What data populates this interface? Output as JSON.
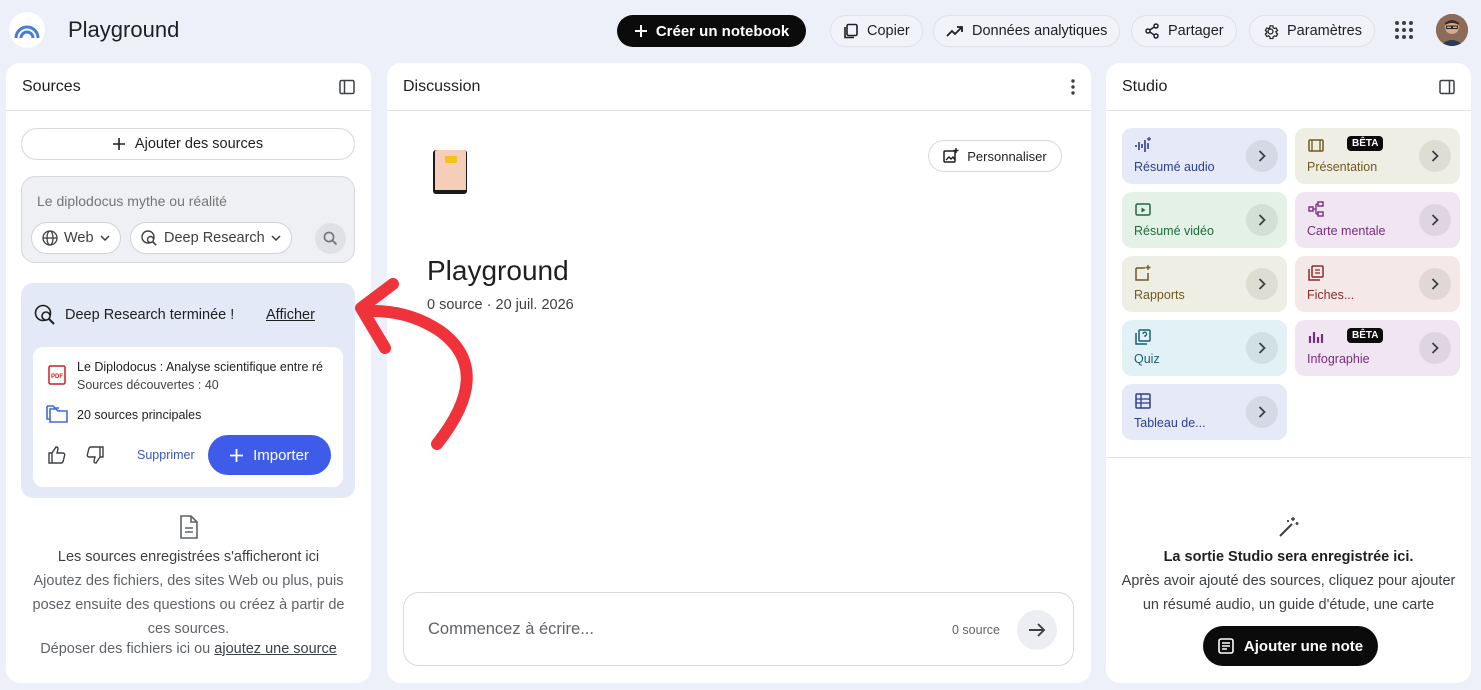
{
  "topbar": {
    "title": "Playground",
    "create_label": "Créer un notebook",
    "copy_label": "Copier",
    "analytics_label": "Données analytiques",
    "share_label": "Partager",
    "settings_label": "Paramètres"
  },
  "sources": {
    "header": "Sources",
    "add_label": "Ajouter des sources",
    "search_placeholder": "Le diplodocus mythe ou réalité",
    "chip_web": "Web",
    "chip_research": "Deep Research",
    "deep_research": {
      "status": "Deep Research terminée !",
      "show_label": "Afficher",
      "doc_title": "Le Diplodocus : Analyse scientifique entre ré",
      "doc_sub": "Sources découvertes : 40",
      "top_sources": "20 sources principales",
      "delete_label": "Supprimer",
      "import_label": "Importer"
    },
    "empty_heading": "Les sources enregistrées s'afficheront ici",
    "empty_text": "Ajoutez des fichiers, des sites Web ou plus, puis posez ensuite des questions ou créez à partir de ces sources.",
    "drop_text": "Déposer des fichiers ici ou",
    "drop_link": "ajoutez une source"
  },
  "discussion": {
    "header": "Discussion",
    "customize_label": "Personnaliser",
    "notebook_title": "Playground",
    "notebook_meta": "0 source · 20 juil. 2026",
    "composer_placeholder": "Commencez à écrire...",
    "composer_count": "0 source"
  },
  "studio": {
    "header": "Studio",
    "tiles": [
      {
        "label": "Résumé audio",
        "icon": "audio-wave-icon",
        "bg": "#e6eaf8",
        "fg": "#2c3e8f"
      },
      {
        "label": "Présentation",
        "icon": "slides-icon",
        "bg": "#eeeee4",
        "fg": "#6d5a1e",
        "beta": "BÊTA"
      },
      {
        "label": "Résumé vidéo",
        "icon": "video-icon",
        "bg": "#e3f1e6",
        "fg": "#1d6b3a"
      },
      {
        "label": "Carte mentale",
        "icon": "mindmap-icon",
        "bg": "#efe6f1",
        "fg": "#7a2c7e"
      },
      {
        "label": "Rapports",
        "icon": "report-icon",
        "bg": "#eeeee4",
        "fg": "#6d5a1e"
      },
      {
        "label": "Fiches...",
        "icon": "flashcards-icon",
        "bg": "#f4e8e8",
        "fg": "#8e2a2a"
      },
      {
        "label": "Quiz",
        "icon": "quiz-icon",
        "bg": "#e1f1f5",
        "fg": "#1b5f74"
      },
      {
        "label": "Infographie",
        "icon": "infographic-icon",
        "bg": "#efe6f1",
        "fg": "#7a2c7e",
        "beta": "BÊTA"
      },
      {
        "label": "Tableau de...",
        "icon": "table-icon",
        "bg": "#e6eaf8",
        "fg": "#2c3e8f"
      }
    ],
    "empty_heading": "La sortie Studio sera enregistrée ici.",
    "empty_text": "Après avoir ajouté des sources, cliquez pour ajouter un résumé audio, un guide d'étude, une carte mentale et bien plus !",
    "add_note_label": "Ajouter une note"
  },
  "colors": {
    "accent": "#3f5bea",
    "annotation_arrow": "#f0323a"
  }
}
